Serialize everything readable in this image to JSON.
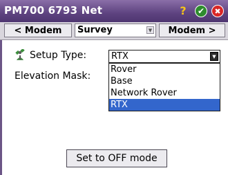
{
  "titlebar": {
    "title": "PM700 6793 Net",
    "icons": [
      "help-icon",
      "ok-icon",
      "close-icon"
    ],
    "help_glyph": "?",
    "ok_glyph": "✔",
    "close_glyph": "✖"
  },
  "navbar": {
    "prev_label": "< Modem",
    "current_page": "Survey",
    "next_label": "Modem >"
  },
  "form": {
    "setup_type_label": "Setup Type:",
    "elevation_mask_label": "Elevation Mask:",
    "setup_type": {
      "selected": "RTX",
      "options": [
        "Rover",
        "Base",
        "Network Rover",
        "RTX"
      ],
      "highlighted_option": "RTX"
    }
  },
  "actions": {
    "off_mode_label": "Set to OFF mode"
  },
  "colors": {
    "titlebar": "#5e4380",
    "selection": "#3366cc",
    "ok_icon": "#2e8b2e",
    "close_icon": "#d92626",
    "help_icon": "#f4c31a"
  }
}
